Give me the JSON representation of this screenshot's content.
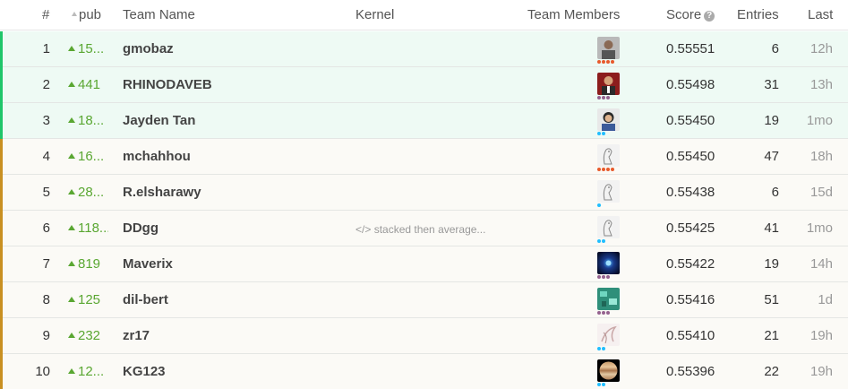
{
  "header": {
    "rank": "#",
    "pub": "pub",
    "team_name": "Team Name",
    "kernel": "Kernel",
    "team_members": "Team Members",
    "score": "Score",
    "entries": "Entries",
    "last": "Last"
  },
  "rows": [
    {
      "rank": "1",
      "delta": "15...",
      "team": "gmobaz",
      "kernel": "",
      "score": "0.55551",
      "entries": "6",
      "last": "12h",
      "medal": "gold",
      "tier_color": "#e85a2c",
      "tier_dots": 4
    },
    {
      "rank": "2",
      "delta": "441",
      "team": "RHINODAVEB",
      "kernel": "",
      "score": "0.55498",
      "entries": "31",
      "last": "13h",
      "medal": "gold",
      "tier_color": "#95628f",
      "tier_dots": 3
    },
    {
      "rank": "3",
      "delta": "18...",
      "team": "Jayden Tan",
      "kernel": "",
      "score": "0.55450",
      "entries": "19",
      "last": "1mo",
      "medal": "gold",
      "tier_color": "#20beff",
      "tier_dots": 2
    },
    {
      "rank": "4",
      "delta": "16...",
      "team": "mchahhou",
      "kernel": "",
      "score": "0.55450",
      "entries": "47",
      "last": "18h",
      "medal": "bronze",
      "tier_color": "#e85a2c",
      "tier_dots": 4
    },
    {
      "rank": "5",
      "delta": "28...",
      "team": "R.elsharawy",
      "kernel": "",
      "score": "0.55438",
      "entries": "6",
      "last": "15d",
      "medal": "bronze",
      "tier_color": "#20beff",
      "tier_dots": 1
    },
    {
      "rank": "6",
      "delta": "118...",
      "team": "DDgg",
      "kernel": "stacked then average...",
      "score": "0.55425",
      "entries": "41",
      "last": "1mo",
      "medal": "bronze",
      "tier_color": "#20beff",
      "tier_dots": 2
    },
    {
      "rank": "7",
      "delta": "819",
      "team": "Maverix",
      "kernel": "",
      "score": "0.55422",
      "entries": "19",
      "last": "14h",
      "medal": "bronze",
      "tier_color": "#95628f",
      "tier_dots": 3
    },
    {
      "rank": "8",
      "delta": "125",
      "team": "dil-bert",
      "kernel": "",
      "score": "0.55416",
      "entries": "51",
      "last": "1d",
      "medal": "bronze",
      "tier_color": "#95628f",
      "tier_dots": 3
    },
    {
      "rank": "9",
      "delta": "232",
      "team": "zr17",
      "kernel": "",
      "score": "0.55410",
      "entries": "21",
      "last": "19h",
      "medal": "bronze",
      "tier_color": "#20beff",
      "tier_dots": 2
    },
    {
      "rank": "10",
      "delta": "12...",
      "team": "KG123",
      "kernel": "",
      "score": "0.55396",
      "entries": "22",
      "last": "19h",
      "medal": "bronze",
      "tier_color": "#20beff",
      "tier_dots": 2
    }
  ]
}
